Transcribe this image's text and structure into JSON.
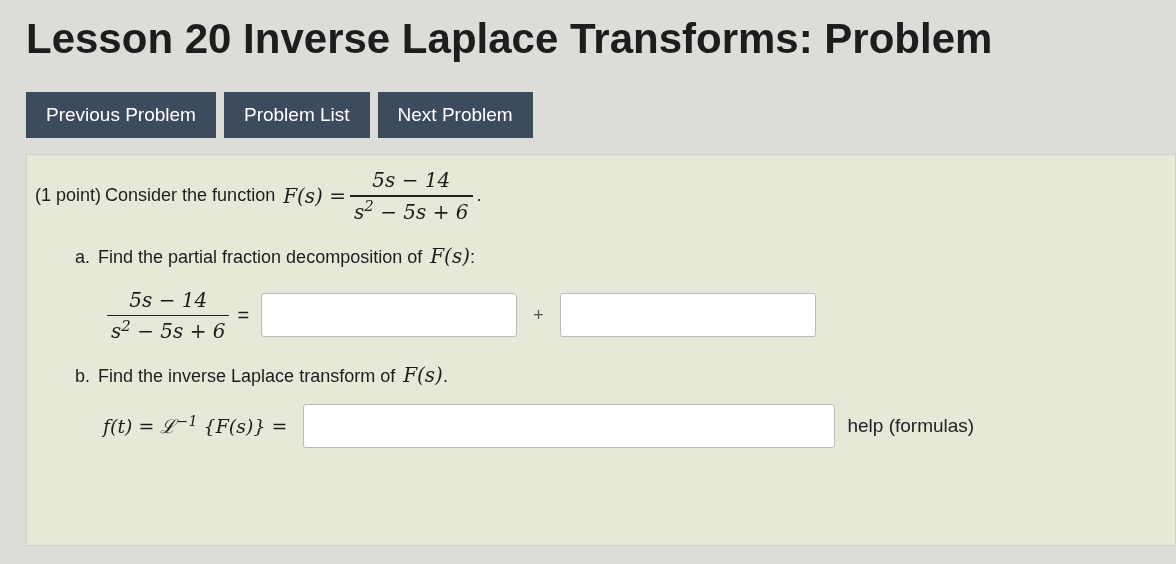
{
  "title": "Lesson 20 Inverse Laplace Transforms: Problem",
  "nav_buttons": [
    "Previous Problem",
    "Problem List",
    "Next Problem"
  ],
  "problem": {
    "points": "(1 point)",
    "intro": "Consider the function",
    "lhs": "F(s) =",
    "numerator": "5s − 14",
    "denominator": "s$^{2}$ − 5s + 6",
    "end": "."
  },
  "parts": [
    {
      "marker": "a.",
      "text": "Find the partial fraction decomposition of",
      "math": "F(s)",
      "suffix": ":",
      "equation": {
        "kind": "fraction",
        "numerator": "5s − 14",
        "denominator": "s$^{2}$ − 5s + 6",
        "lhs": "=",
        "terms": [
          {
            "kind": "field"
          },
          {
            "kind": "operator",
            "text": "+"
          },
          {
            "kind": "field"
          }
        ]
      }
    },
    {
      "marker": "b.",
      "text": "Find the inverse Laplace transform of",
      "math": "F(s)",
      "suffix": ".",
      "equation": {
        "kind": "plain",
        "lhs": "f(t) = ℒ$^{−1}$ {F(s)} =",
        "terms": [
          {
            "kind": "field"
          },
          {
            "kind": "link",
            "text": "help (formulas)"
          }
        ]
      }
    }
  ]
}
